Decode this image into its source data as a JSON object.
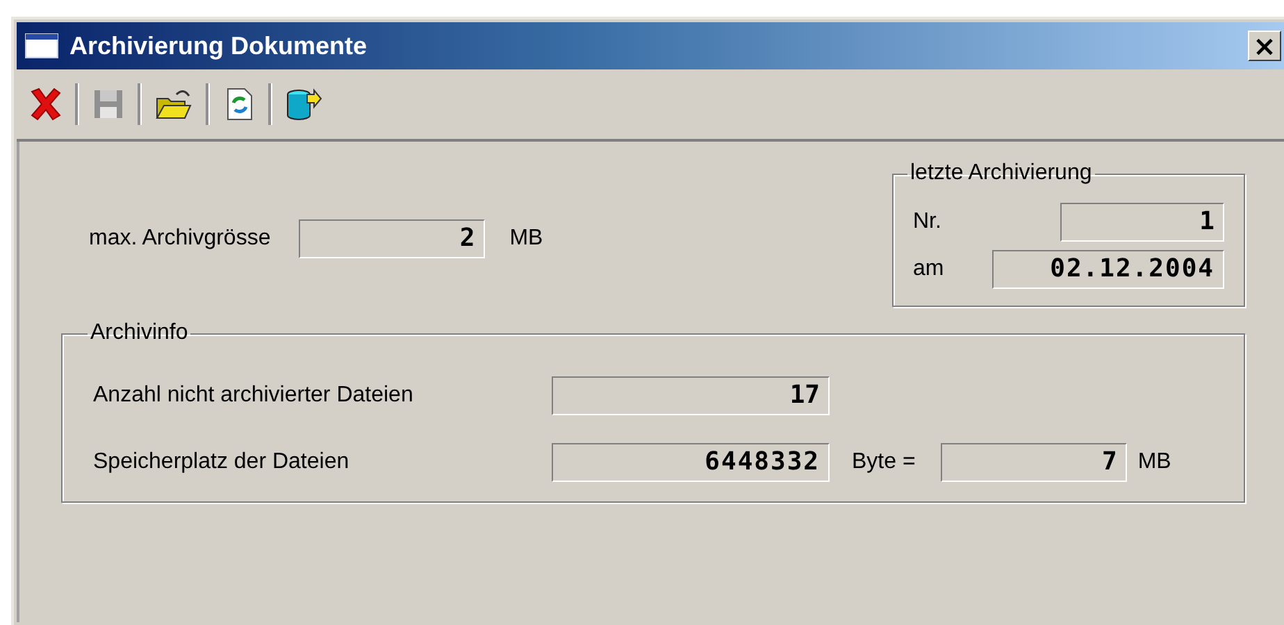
{
  "window": {
    "title": "Archivierung Dokumente",
    "close": "×"
  },
  "toolbar": [
    {
      "kind": "delete",
      "disabled": false
    },
    {
      "kind": "save",
      "disabled": true
    },
    {
      "kind": "open",
      "disabled": false
    },
    {
      "kind": "refresh",
      "disabled": false
    },
    {
      "kind": "database",
      "disabled": false
    }
  ],
  "max_size": {
    "label": "max. Archivgrösse",
    "value": "2",
    "unit": "MB"
  },
  "last_archive": {
    "title": "letzte Archivierung",
    "number_label": "Nr.",
    "number": "1",
    "date_label": "am",
    "date": "02.12.2004"
  },
  "archive_info": {
    "title": "Archivinfo",
    "files_label": "Anzahl nicht archivierter Dateien",
    "files": "17",
    "size_label": "Speicherplatz der Dateien",
    "bytes": "6448332",
    "bytes_unit": "Byte =",
    "megabytes": "7",
    "mb_unit": "MB"
  }
}
